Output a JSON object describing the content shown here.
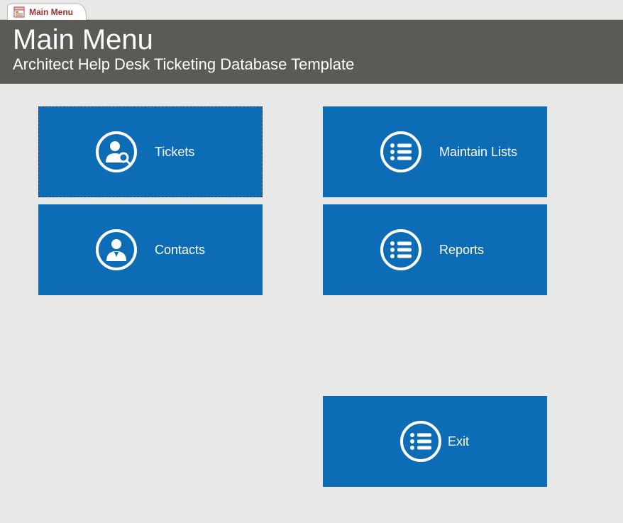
{
  "tab": {
    "label": "Main Menu"
  },
  "header": {
    "title": "Main Menu",
    "subtitle": "Architect Help Desk Ticketing Database Template"
  },
  "tiles": {
    "tickets": {
      "label": "Tickets"
    },
    "maintain": {
      "label": "Maintain Lists"
    },
    "contacts": {
      "label": "Contacts"
    },
    "reports": {
      "label": "Reports"
    },
    "exit": {
      "label": "Exit"
    }
  }
}
